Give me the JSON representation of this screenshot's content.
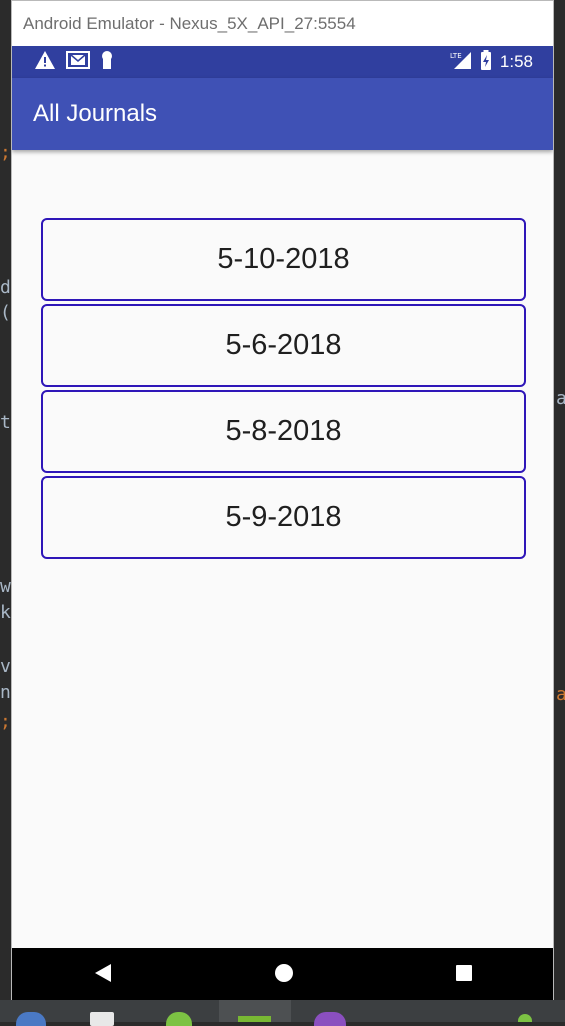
{
  "emulator": {
    "window_title": "Android Emulator - Nexus_5X_API_27:5554"
  },
  "statusbar": {
    "time": "1:58",
    "network_label": "LTE"
  },
  "appbar": {
    "title": "All Journals"
  },
  "journals": [
    {
      "label": "5-10-2018"
    },
    {
      "label": "5-6-2018"
    },
    {
      "label": "5-8-2018"
    },
    {
      "label": "5-9-2018"
    }
  ],
  "colors": {
    "statusbar": "#303f9f",
    "appbar": "#3f51b5",
    "item_border": "#2e16b8"
  },
  "icons": {
    "status_left": [
      "warning-icon",
      "mail-icon",
      "keyhole-icon"
    ],
    "status_right": [
      "lte-signal-icon",
      "battery-icon"
    ],
    "nav": [
      "back-icon",
      "home-icon",
      "recents-icon"
    ]
  }
}
